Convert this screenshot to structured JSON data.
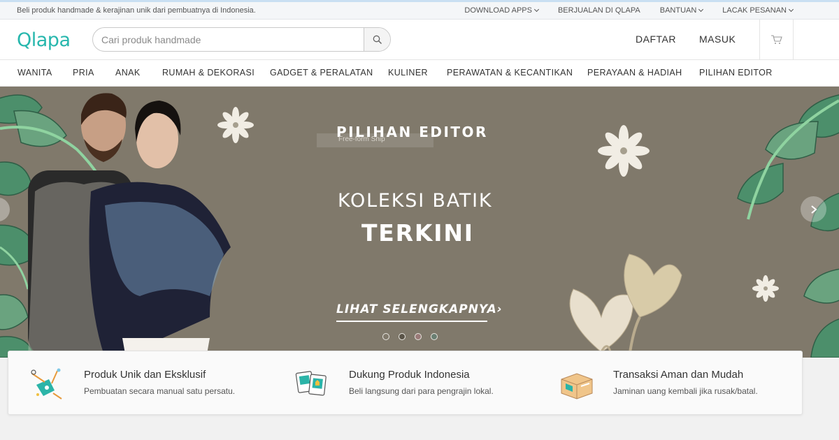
{
  "topbar": {
    "tagline": "Beli produk handmade & kerajinan unik dari pembuatnya di Indonesia.",
    "download_apps": "DOWNLOAD APPS",
    "berjualan": "BERJUALAN DI QLAPA",
    "bantuan": "BANTUAN",
    "lacak": "LACAK PESANAN"
  },
  "header": {
    "logo": "Qlapa",
    "search_placeholder": "Cari produk handmade",
    "search_value": "",
    "daftar": "DAFTAR",
    "masuk": "MASUK"
  },
  "categories": [
    "WANITA",
    "PRIA",
    "ANAK",
    "RUMAH & DEKORASI",
    "GADGET & PERALATAN",
    "KULINER",
    "PERAWATAN & KECANTIKAN",
    "PERAYAAN & HADIAH",
    "PILIHAN EDITOR"
  ],
  "banner": {
    "kicker": "PILIHAN EDITOR",
    "snip_label": "Free-form Snip",
    "title_line1": "KOLEKSI BATIK",
    "title_line2": "TERKINI",
    "cta": "LIHAT SELENGKAPNYA",
    "cta_arrow": "›",
    "slide_count": 4,
    "bg_color": "#80796b"
  },
  "features": [
    {
      "title": "Produk Unik dan Eksklusif",
      "desc": "Pembuatan secara manual satu persatu.",
      "icon": "craft-tools-icon"
    },
    {
      "title": "Dukung Produk Indonesia",
      "desc": "Beli langsung dari para pengrajin lokal.",
      "icon": "local-products-icon"
    },
    {
      "title": "Transaksi Aman dan Mudah",
      "desc": "Jaminan uang kembali jika rusak/batal.",
      "icon": "package-icon"
    }
  ],
  "colors": {
    "brand": "#27b7ad",
    "leaf": "#4a8c68"
  }
}
